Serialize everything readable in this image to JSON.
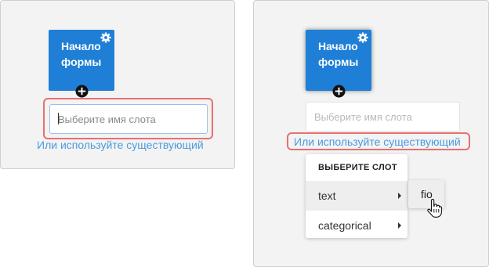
{
  "left_panel": {
    "start_node": {
      "line1": "Начало",
      "line2": "формы",
      "settings_icon": "gear-icon",
      "add_icon": "plus-icon"
    },
    "slot_input": {
      "placeholder": "Выберите имя слота",
      "value": ""
    },
    "existing_link": "Или используйте существующий"
  },
  "right_panel": {
    "start_node": {
      "line1": "Начало",
      "line2": "формы",
      "settings_icon": "gear-icon",
      "add_icon": "plus-icon"
    },
    "slot_input": {
      "placeholder": "Выберите имя слота",
      "value": ""
    },
    "existing_link": "Или используйте существующий",
    "menu": {
      "header": "ВЫБЕРИТЕ СЛОТ",
      "items": [
        {
          "label": "text",
          "has_submenu": true
        },
        {
          "label": "categorical",
          "has_submenu": true
        }
      ],
      "submenu": {
        "items": [
          {
            "label": "fio"
          }
        ]
      }
    },
    "cursor_icon": "hand-pointer-icon"
  },
  "colors": {
    "node": "#1f7fd6",
    "link": "#4a9be0",
    "highlight": "#e8706f",
    "panel": "#f3f3f3"
  }
}
